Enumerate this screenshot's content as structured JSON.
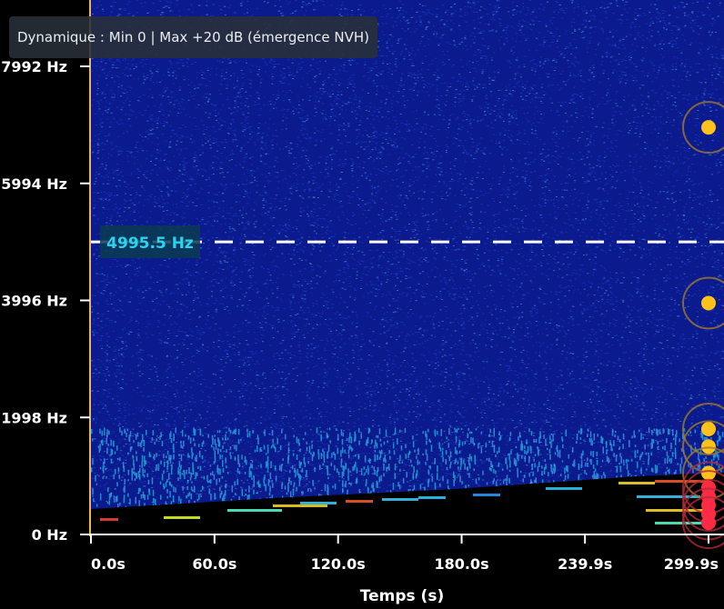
{
  "info_text": "Dynamique : Min 0 | Max +20 dB (émergence NVH)",
  "chart_data": {
    "type": "heatmap",
    "title": "",
    "xlabel": "Temps (s)",
    "ylabel": "",
    "x_ticks": [
      {
        "value": 0.0,
        "label": "0.0s"
      },
      {
        "value": 60.0,
        "label": "60.0s"
      },
      {
        "value": 120.0,
        "label": "120.0s"
      },
      {
        "value": 180.0,
        "label": "180.0s"
      },
      {
        "value": 239.9,
        "label": "239.9s"
      },
      {
        "value": 299.9,
        "label": "299.9s"
      }
    ],
    "y_ticks": [
      {
        "value": 0,
        "label": "0 Hz"
      },
      {
        "value": 1998,
        "label": "1998 Hz"
      },
      {
        "value": 3996,
        "label": "3996 Hz"
      },
      {
        "value": 5994,
        "label": "5994 Hz"
      },
      {
        "value": 7992,
        "label": "7992 Hz"
      }
    ],
    "xlim": [
      0,
      299.9
    ],
    "ylim": [
      0,
      7992
    ],
    "cursor": {
      "frequency": 4995.5,
      "label": "4995.5 Hz"
    },
    "colormap": "jet",
    "dynamic_range_db": [
      0,
      20
    ],
    "peak_markers": [
      {
        "time": 299.9,
        "frequency": 6950,
        "level": "medium"
      },
      {
        "time": 299.9,
        "frequency": 3950,
        "level": "medium"
      },
      {
        "time": 299.9,
        "frequency": 1800,
        "level": "medium"
      },
      {
        "time": 299.9,
        "frequency": 1500,
        "level": "medium"
      },
      {
        "time": 299.9,
        "frequency": 1050,
        "level": "medium"
      },
      {
        "time": 299.9,
        "frequency": 800,
        "level": "high"
      },
      {
        "time": 299.9,
        "frequency": 650,
        "level": "high"
      },
      {
        "time": 299.9,
        "frequency": 500,
        "level": "high"
      },
      {
        "time": 299.9,
        "frequency": 350,
        "level": "high"
      },
      {
        "time": 299.9,
        "frequency": 200,
        "level": "high"
      }
    ],
    "colors": {
      "axis": "#f2b24c",
      "cursor_label": "#2ad4f0",
      "marker_medium": "#ffc21a",
      "marker_high": "#ff2b45",
      "noise_floor": "#0a1890"
    }
  }
}
